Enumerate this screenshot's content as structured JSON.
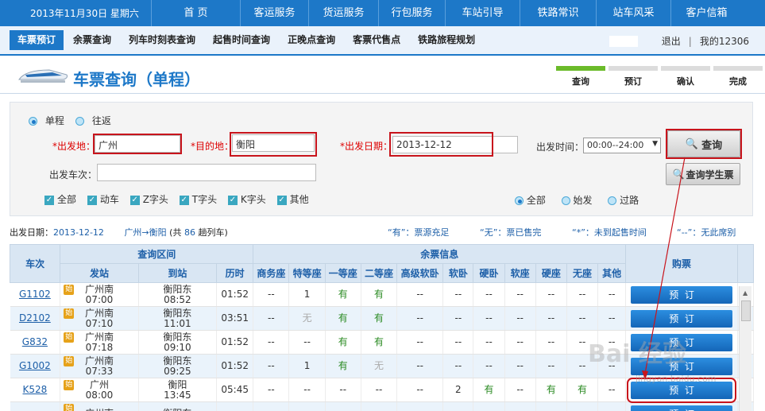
{
  "topnav": {
    "date": "2013年11月30日 星期六",
    "items": [
      "首 页",
      "客运服务",
      "货运服务",
      "行包服务",
      "车站引导",
      "铁路常识",
      "站车风采",
      "客户信箱"
    ]
  },
  "subnav": {
    "tabs": [
      "车票预订",
      "余票查询",
      "列车时刻表查询",
      "起售时间查询",
      "正晚点查询",
      "客票代售点",
      "铁路旅程规划"
    ],
    "logout": "退出",
    "my12306": "我的12306"
  },
  "header": {
    "title": "车票查询（单程）",
    "steps": [
      "查询",
      "预订",
      "确认",
      "完成"
    ]
  },
  "search": {
    "trip_one_way": "单程",
    "trip_round": "往返",
    "from_label": "*出发地：",
    "from_value": "广州",
    "to_label": "*目的地：",
    "to_value": "衡阳",
    "date_label": "*出发日期：",
    "date_value": "2013-12-12",
    "time_label": "出发时间：",
    "time_value": "00:00--24:00",
    "train_label": "出发车次：",
    "train_value": "",
    "types": [
      "全部",
      "动车",
      "Z字头",
      "T字头",
      "K字头",
      "其他"
    ],
    "station_filters": [
      "全部",
      "始发",
      "过路"
    ],
    "query_button": "查询",
    "student_button": "查询学生票"
  },
  "summary": {
    "date_label": "出发日期：",
    "date_value": "2013-12-12",
    "route": "广州→衡阳",
    "count_prefix": "(共",
    "count": "86",
    "count_suffix": "趟列车)",
    "legend": [
      "“有”：票源充足",
      "“无”：票已售完",
      "“*”：未到起售时间",
      "“--”：无此席别"
    ]
  },
  "table": {
    "group_headers": [
      "查询区间",
      "余票信息"
    ],
    "col_train": "车次",
    "col_from": "发站",
    "col_to": "到站",
    "col_duration": "历时",
    "seat_headers": [
      "商务座",
      "特等座",
      "一等座",
      "二等座",
      "高级软卧",
      "软卧",
      "硬卧",
      "软座",
      "硬座",
      "无座",
      "其他"
    ],
    "col_book": "购票",
    "book_label": "预  订",
    "start_badge": "始",
    "rows": [
      {
        "train": "G1102",
        "from": "广州南",
        "dep": "07:00",
        "to": "衡阳东",
        "arr": "08:52",
        "dur": "01:52",
        "seats": [
          "--",
          "1",
          "有",
          "有",
          "--",
          "--",
          "--",
          "--",
          "--",
          "--",
          "--"
        ],
        "start": true
      },
      {
        "train": "D2102",
        "from": "广州南",
        "dep": "07:10",
        "to": "衡阳东",
        "arr": "11:01",
        "dur": "03:51",
        "seats": [
          "--",
          "无",
          "有",
          "有",
          "--",
          "--",
          "--",
          "--",
          "--",
          "--",
          "--"
        ],
        "start": true
      },
      {
        "train": "G832",
        "from": "广州南",
        "dep": "07:18",
        "to": "衡阳东",
        "arr": "09:10",
        "dur": "01:52",
        "seats": [
          "--",
          "--",
          "有",
          "有",
          "--",
          "--",
          "--",
          "--",
          "--",
          "--",
          "--"
        ],
        "start": true
      },
      {
        "train": "G1002",
        "from": "广州南",
        "dep": "07:33",
        "to": "衡阳东",
        "arr": "09:25",
        "dur": "01:52",
        "seats": [
          "--",
          "1",
          "有",
          "无",
          "--",
          "--",
          "--",
          "--",
          "--",
          "--",
          "--"
        ],
        "start": true
      },
      {
        "train": "K528",
        "from": "广州",
        "dep": "08:00",
        "to": "衡阳",
        "arr": "13:45",
        "dur": "05:45",
        "seats": [
          "--",
          "--",
          "--",
          "--",
          "--",
          "2",
          "有",
          "--",
          "有",
          "有",
          "--"
        ],
        "start": true
      },
      {
        "train": "",
        "from": "广州南",
        "dep": "",
        "to": "衡阳东",
        "arr": "",
        "dur": "",
        "seats": [
          "",
          "",
          "",
          "",
          "",
          "",
          "",
          "",
          "",
          "",
          ""
        ],
        "start": true
      }
    ]
  },
  "watermark": {
    "main": "Bai 经验",
    "sub": "jingyan.baidu.com"
  }
}
